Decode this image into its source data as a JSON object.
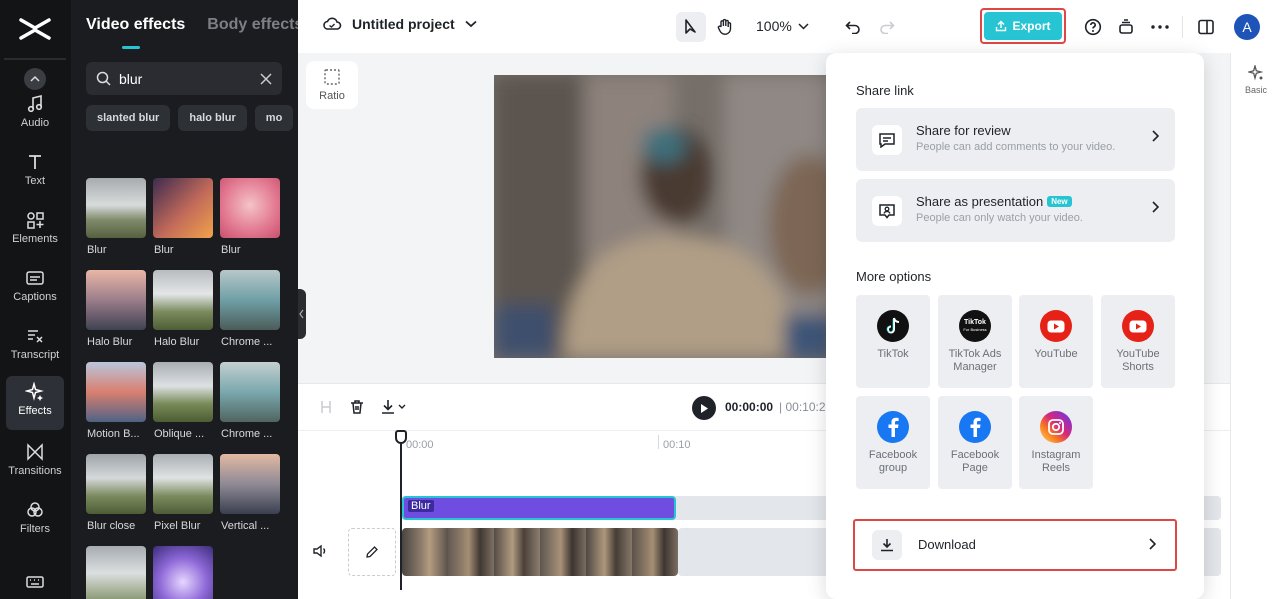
{
  "rail": {
    "items": [
      {
        "label": "Audio",
        "icon": "music-note-icon"
      },
      {
        "label": "Text",
        "icon": "text-icon"
      },
      {
        "label": "Elements",
        "icon": "elements-icon"
      },
      {
        "label": "Captions",
        "icon": "captions-icon"
      },
      {
        "label": "Transcript",
        "icon": "transcript-icon"
      },
      {
        "label": "Effects",
        "icon": "sparkle-icon",
        "active": true
      },
      {
        "label": "Transitions",
        "icon": "transitions-icon"
      },
      {
        "label": "Filters",
        "icon": "filters-icon"
      }
    ]
  },
  "panel": {
    "tabs": [
      "Video effects",
      "Body effects"
    ],
    "search_value": "blur",
    "chips": [
      "slanted blur",
      "halo blur",
      "mo"
    ],
    "effects": [
      {
        "label": "Blur"
      },
      {
        "label": "Blur"
      },
      {
        "label": "Blur"
      },
      {
        "label": "Halo Blur"
      },
      {
        "label": "Halo Blur"
      },
      {
        "label": "Chrome ..."
      },
      {
        "label": "Motion B..."
      },
      {
        "label": "Oblique ..."
      },
      {
        "label": "Chrome ..."
      },
      {
        "label": "Blur close"
      },
      {
        "label": "Pixel Blur"
      },
      {
        "label": "Vertical ..."
      },
      {
        "label": ""
      },
      {
        "label": ""
      }
    ]
  },
  "topbar": {
    "project_name": "Untitled project",
    "zoom": "100%",
    "export_label": "Export",
    "avatar_letter": "A"
  },
  "canvas": {
    "ratio_label": "Ratio"
  },
  "right_sidebar": {
    "basic_label": "Basic"
  },
  "timeline": {
    "current_time": "00:00:00",
    "total_time": "| 00:10:2",
    "ticks": [
      "00:00",
      "00:10"
    ],
    "effect_clip_label": "Blur"
  },
  "export_popover": {
    "share_heading": "Share link",
    "share_items": [
      {
        "title": "Share for review",
        "subtitle": "People can add comments to your video.",
        "badge": ""
      },
      {
        "title": "Share as presentation",
        "subtitle": "People can only watch your video.",
        "badge": "New"
      }
    ],
    "more_heading": "More options",
    "options": [
      {
        "label": "TikTok",
        "icon": "tiktok-icon"
      },
      {
        "label": "TikTok Ads Manager",
        "icon": "tiktok-business-icon"
      },
      {
        "label": "YouTube",
        "icon": "youtube-icon"
      },
      {
        "label": "YouTube Shorts",
        "icon": "youtube-shorts-icon"
      },
      {
        "label": "Facebook group",
        "icon": "facebook-icon"
      },
      {
        "label": "Facebook Page",
        "icon": "facebook-icon"
      },
      {
        "label": "Instagram Reels",
        "icon": "instagram-icon"
      }
    ],
    "download_label": "Download",
    "tiktok_business_text": "TikTok",
    "tiktok_business_sub": "For Business"
  },
  "colors": {
    "accent": "#27c4d4",
    "highlight": "#e04646",
    "effect_clip": "#6e4de0"
  }
}
